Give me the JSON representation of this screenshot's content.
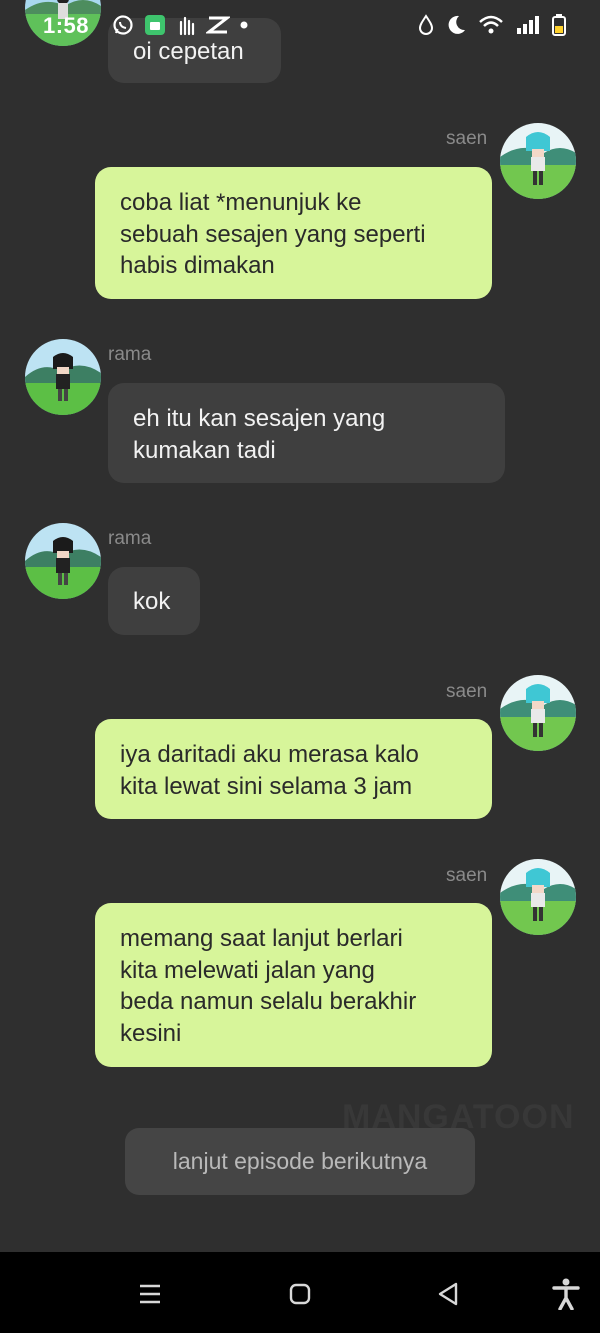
{
  "status_bar": {
    "time": "1:58",
    "icons_left": [
      "avatar-icon",
      "whatsapp-icon",
      "app-icon",
      "gesture-icon",
      "capcut-icon",
      "dot-icon"
    ],
    "icons_right": [
      "drop-icon",
      "moon-icon",
      "wifi-icon",
      "signal-icon",
      "battery-icon"
    ]
  },
  "messages": [
    {
      "side": "left",
      "name": "",
      "text": "oi cepetan"
    },
    {
      "side": "right",
      "name": "saen",
      "text": "coba liat *menunjuk ke\nsebuah sesajen yang seperti\nhabis dimakan"
    },
    {
      "side": "left",
      "name": "rama",
      "text": "eh itu kan sesajen yang\nkumakan tadi"
    },
    {
      "side": "left",
      "name": "rama",
      "text": "kok"
    },
    {
      "side": "right",
      "name": "saen",
      "text": "iya daritadi aku merasa kalo\nkita lewat sini selama 3 jam"
    },
    {
      "side": "right",
      "name": "saen",
      "text": "memang saat lanjut berlari\nkita melewati jalan yang\nbeda namun selalu berakhir\nkesini"
    }
  ],
  "watermark": "MANGATOON",
  "next_episode_label": "lanjut episode berikutnya",
  "nav_bar": {
    "buttons": [
      "menu-icon",
      "home-icon",
      "back-icon",
      "accessibility-icon"
    ]
  },
  "colors": {
    "background": "#2f2f2f",
    "bubble_right": "#d7f59a",
    "bubble_left": "#3f3f3f",
    "name": "#8a8a8a"
  }
}
